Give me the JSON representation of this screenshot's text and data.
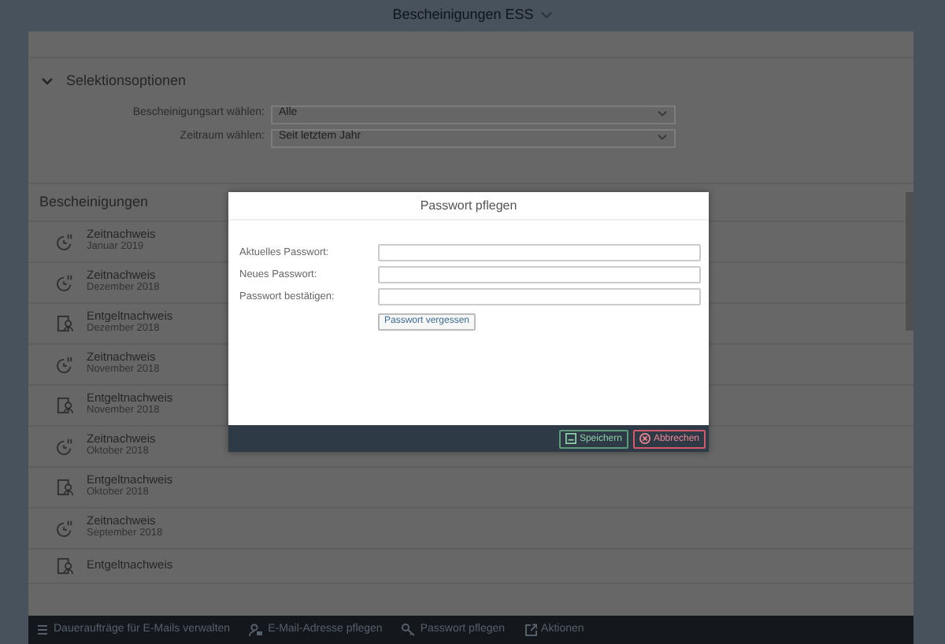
{
  "shell": {
    "title": "Bescheinigungen ESS"
  },
  "selection": {
    "title": "Selektionsoptionen",
    "expanded": true,
    "fields": [
      {
        "label": "Bescheinigungsart wählen:",
        "value": "Alle"
      },
      {
        "label": "Zeitraum wählen:",
        "value": "Seit letztem Jahr"
      }
    ]
  },
  "list": {
    "title": "Bescheinigungen",
    "items": [
      {
        "kind": "time",
        "title": "Zeitnachweis",
        "subtitle": "Januar 2019"
      },
      {
        "kind": "time",
        "title": "Zeitnachweis",
        "subtitle": "Dezember 2018"
      },
      {
        "kind": "pay",
        "title": "Entgeltnachweis",
        "subtitle": "Dezember 2018"
      },
      {
        "kind": "time",
        "title": "Zeitnachweis",
        "subtitle": "November 2018"
      },
      {
        "kind": "pay",
        "title": "Entgeltnachweis",
        "subtitle": "November 2018"
      },
      {
        "kind": "time",
        "title": "Zeitnachweis",
        "subtitle": "Oktober 2018"
      },
      {
        "kind": "pay",
        "title": "Entgeltnachweis",
        "subtitle": "Oktober 2018"
      },
      {
        "kind": "time",
        "title": "Zeitnachweis",
        "subtitle": "September 2018"
      },
      {
        "kind": "pay",
        "title": "Entgeltnachweis"
      }
    ]
  },
  "footer": [
    {
      "kind": "list",
      "label": "Daueraufträge für E-Mails verwalten"
    },
    {
      "kind": "person",
      "label": "E-Mail-Adresse pflegen"
    },
    {
      "kind": "key",
      "label": "Passwort pflegen"
    },
    {
      "kind": "share",
      "label": "Aktionen"
    }
  ],
  "dialog": {
    "title": "Passwort pflegen",
    "fields": [
      {
        "label": "Aktuelles Passwort:"
      },
      {
        "label": "Neues Passwort:"
      },
      {
        "label": "Passwort bestätigen:"
      }
    ],
    "link_button": "Passwort vergessen",
    "buttons": [
      {
        "kind": "save",
        "label": "Speichern"
      },
      {
        "kind": "cancel",
        "label": "Abbrechen"
      }
    ]
  }
}
